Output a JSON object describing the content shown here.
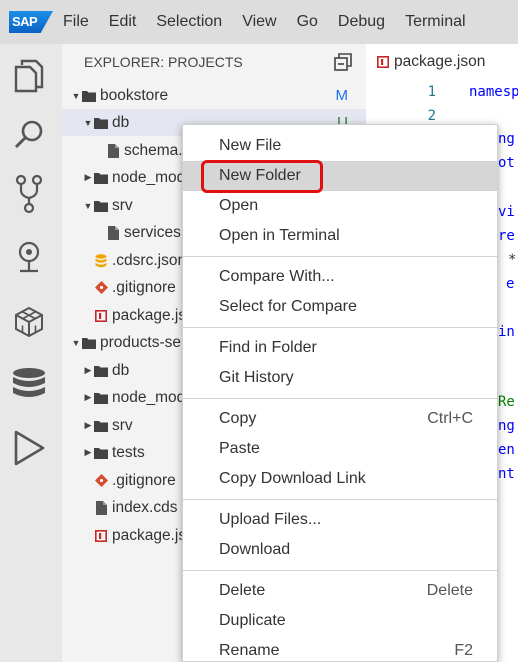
{
  "menubar": {
    "logo": "SAP",
    "items": [
      "File",
      "Edit",
      "Selection",
      "View",
      "Go",
      "Debug",
      "Terminal"
    ]
  },
  "activity_icons": [
    "files-icon",
    "search-icon",
    "source-control-icon",
    "debug-pin-icon",
    "extensions-icon",
    "database-icon",
    "run-icon"
  ],
  "explorer": {
    "title": "EXPLORER: PROJECTS",
    "tree": [
      {
        "label": "bookstore",
        "kind": "folder",
        "depth": 0,
        "twisty": "down",
        "badge": "M",
        "badge_color": "#1a73e8"
      },
      {
        "label": "db",
        "kind": "folder",
        "depth": 1,
        "twisty": "down",
        "badge": "U",
        "badge_color": "#2e7d32",
        "selected": true
      },
      {
        "label": "schema.cds",
        "kind": "file",
        "depth": 2
      },
      {
        "label": "node_modules",
        "kind": "folder",
        "depth": 1,
        "twisty": "right"
      },
      {
        "label": "srv",
        "kind": "folder",
        "depth": 1,
        "twisty": "down"
      },
      {
        "label": "services.cds",
        "kind": "file",
        "depth": 2
      },
      {
        "label": ".cdsrc.json",
        "kind": "db-file",
        "depth": 1
      },
      {
        "label": ".gitignore",
        "kind": "git-file",
        "depth": 1
      },
      {
        "label": "package.json",
        "kind": "npm-file",
        "depth": 1
      },
      {
        "label": "products-service",
        "kind": "folder",
        "depth": 0,
        "twisty": "down"
      },
      {
        "label": "db",
        "kind": "folder",
        "depth": 1,
        "twisty": "right"
      },
      {
        "label": "node_modules",
        "kind": "folder",
        "depth": 1,
        "twisty": "right"
      },
      {
        "label": "srv",
        "kind": "folder",
        "depth": 1,
        "twisty": "right"
      },
      {
        "label": "tests",
        "kind": "folder",
        "depth": 1,
        "twisty": "right"
      },
      {
        "label": ".gitignore",
        "kind": "git-file",
        "depth": 1
      },
      {
        "label": "index.cds",
        "kind": "file",
        "depth": 1
      },
      {
        "label": "package.json",
        "kind": "npm-file",
        "depth": 1
      }
    ]
  },
  "editor": {
    "tab_label": "package.json",
    "lines": [
      {
        "num": "1",
        "text": "namespace"
      },
      {
        "num": "2",
        "text": ""
      }
    ],
    "fragments": [
      "ng",
      "ot",
      "vi",
      "re",
      "*",
      "e",
      "in",
      "Re",
      "ng",
      "en",
      "nt"
    ]
  },
  "context_menu": {
    "groups": [
      [
        {
          "label": "New File",
          "key": ""
        },
        {
          "label": "New Folder",
          "key": "",
          "highlighted": true
        },
        {
          "label": "Open",
          "key": ""
        },
        {
          "label": "Open in Terminal",
          "key": ""
        }
      ],
      [
        {
          "label": "Compare With...",
          "key": ""
        },
        {
          "label": "Select for Compare",
          "key": ""
        }
      ],
      [
        {
          "label": "Find in Folder",
          "key": ""
        },
        {
          "label": "Git History",
          "key": ""
        }
      ],
      [
        {
          "label": "Copy",
          "key": "Ctrl+C"
        },
        {
          "label": "Paste",
          "key": ""
        },
        {
          "label": "Copy Download Link",
          "key": ""
        }
      ],
      [
        {
          "label": "Upload Files...",
          "key": ""
        },
        {
          "label": "Download",
          "key": ""
        }
      ],
      [
        {
          "label": "Delete",
          "key": "Delete"
        },
        {
          "label": "Duplicate",
          "key": ""
        },
        {
          "label": "Rename",
          "key": "F2"
        }
      ]
    ]
  },
  "colors": {
    "highlight_box": "#e01010",
    "folder": "#424242",
    "selected_row": "#e4e6f1"
  }
}
